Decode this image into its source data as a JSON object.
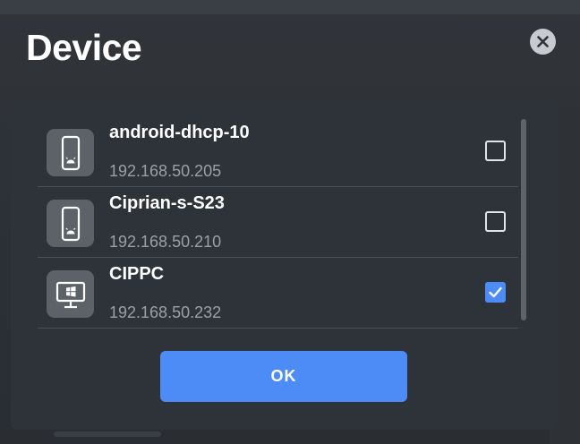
{
  "dialog": {
    "title": "Device",
    "ok_label": "OK"
  },
  "devices": [
    {
      "name": "android-dhcp-10",
      "ip": "192.168.50.205",
      "icon": "phone-icon",
      "checked": false
    },
    {
      "name": "Ciprian-s-S23",
      "ip": "192.168.50.210",
      "icon": "phone-icon",
      "checked": false
    },
    {
      "name": "CIPPC",
      "ip": "192.168.50.232",
      "icon": "windows-pc-icon",
      "checked": true
    }
  ],
  "colors": {
    "accent": "#4d8cf6",
    "panel": "#2e3339",
    "icon_tile": "#5c6268"
  }
}
